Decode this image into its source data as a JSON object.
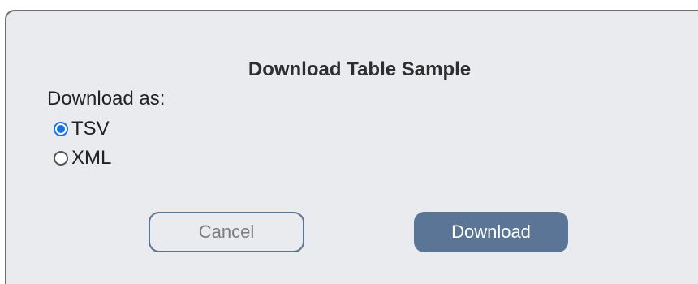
{
  "dialog": {
    "title": "Download Table Sample",
    "format_label": "Download as:",
    "options": [
      {
        "label": "TSV",
        "selected": true
      },
      {
        "label": "XML",
        "selected": false
      }
    ],
    "cancel_label": "Cancel",
    "download_label": "Download"
  },
  "colors": {
    "dialog_background": "#e9ebef",
    "primary_button": "#5a7595",
    "radio_selected": "#1a73e8"
  }
}
